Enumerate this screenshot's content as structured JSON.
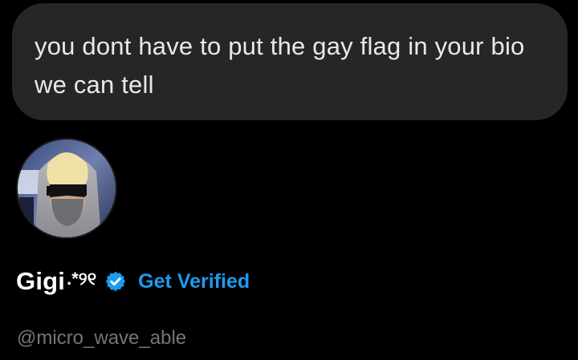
{
  "message": {
    "text": "you dont have to put the gay flag in your bio we can tell"
  },
  "profile": {
    "avatar_icon": "profile-photo",
    "display_name": "Gigi",
    "name_symbols": ".*୨୧",
    "verified_icon": "verified-badge-icon",
    "get_verified_label": "Get Verified",
    "handle": "@micro_wave_able"
  },
  "colors": {
    "background": "#000000",
    "bubble": "#262626",
    "accent": "#1d9bf0",
    "handle": "#71767b"
  }
}
